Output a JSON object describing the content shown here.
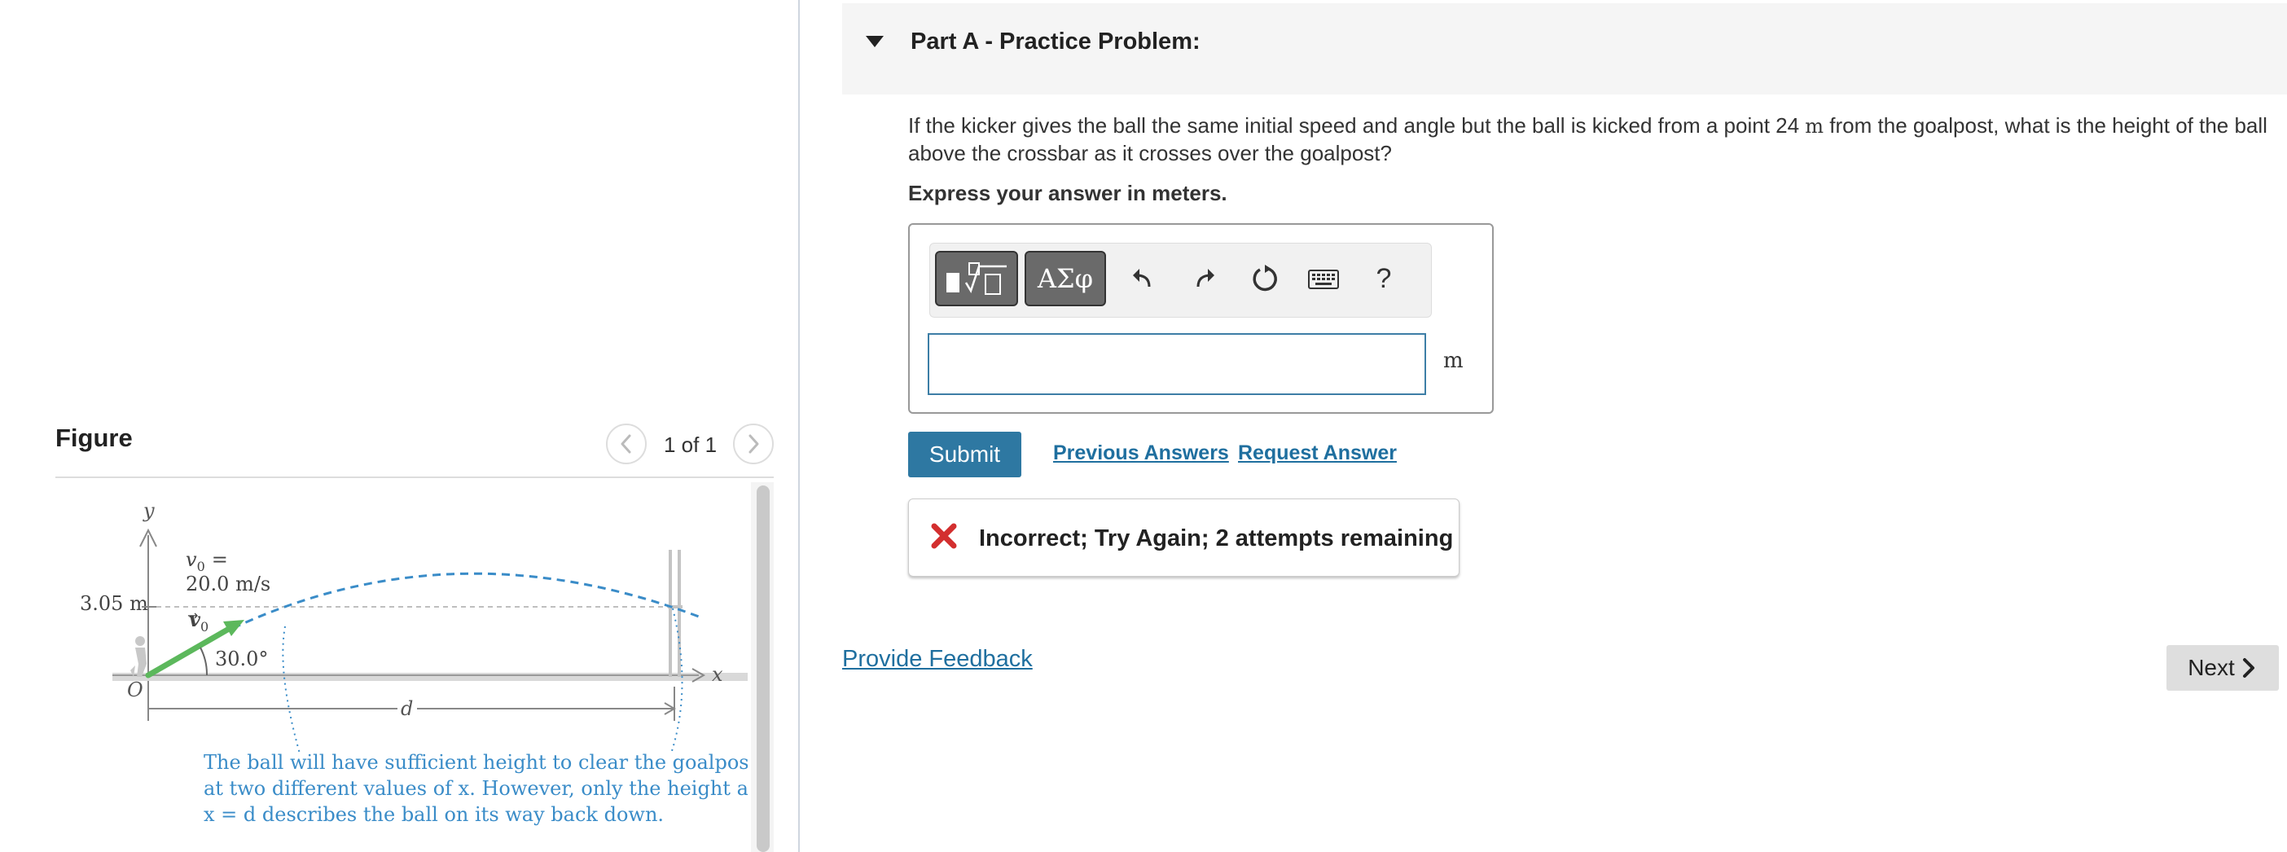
{
  "figure": {
    "title": "Figure",
    "counter": "1 of 1",
    "y_axis": "y",
    "x_axis": "x",
    "origin": "O",
    "height_label": "3.05 m",
    "v0_label": "v",
    "v0_sub": "0",
    "v0_eq": "=",
    "v0_value": "20.0 m/s",
    "vec_label": "v",
    "vec_sub": "0",
    "angle_label": "30.0°",
    "d_label": "d",
    "caption_lines": [
      "The ball will have sufficient height to clear the goalpost",
      "at two different values of x. However, only the height at",
      "x = d describes the ball on its way back down."
    ]
  },
  "part": {
    "title": "Part A - Practice Problem:"
  },
  "question": {
    "text_before": "If the kicker gives the ball the same initial speed and angle but the ball is kicked from a point 24 ",
    "unit": "m",
    "text_after": " from the goalpost, what is the height of the ball above the crossbar as it crosses over the goalpost?",
    "instruction": "Express your answer in meters."
  },
  "toolbar": {
    "symbols_label": "ΑΣφ",
    "help_label": "?",
    "icons": [
      "templates-icon",
      "greek-symbols-icon",
      "undo-icon",
      "redo-icon",
      "reset-icon",
      "keyboard-icon",
      "help-icon"
    ]
  },
  "answer": {
    "value": "",
    "unit": "m"
  },
  "actions": {
    "submit_label": "Submit",
    "previous_answers_label": "Previous Answers",
    "request_answer_label": "Request Answer"
  },
  "feedback": {
    "message": "Incorrect; Try Again; 2 attempts remaining",
    "status_color": "#d32f2f"
  },
  "footer": {
    "provide_feedback_label": "Provide Feedback",
    "next_label": "Next"
  },
  "colors": {
    "accent": "#2e78a2",
    "link": "#1f6f9f",
    "trajectory": "#3a8cc8",
    "velocity_vector": "#5cb85c"
  }
}
